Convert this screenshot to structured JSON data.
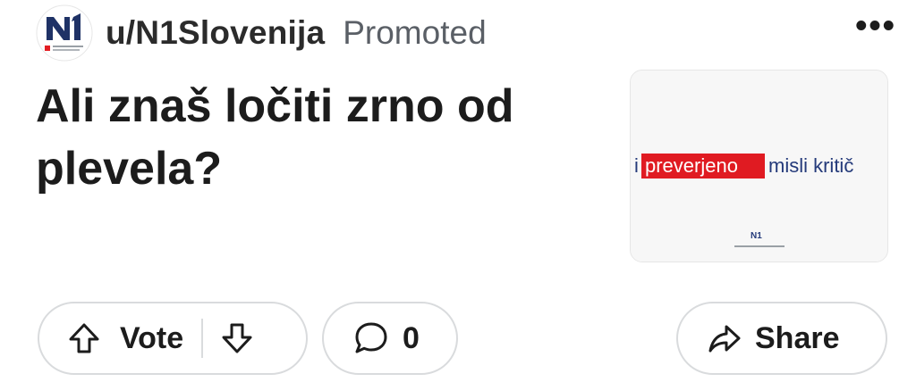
{
  "post": {
    "username": "u/N1Slovenija",
    "promoted_label": "Promoted",
    "more_label": "•••",
    "title": "Ali znaš ločiti zrno od plevela?",
    "thumbnail": {
      "ad_text_highlight": "preverjeno",
      "ad_text_prefix": "i",
      "ad_text_rest": "misli kritič",
      "brand_mark": "N1"
    }
  },
  "actions": {
    "vote_label": "Vote",
    "comment_count": "0",
    "share_label": "Share"
  },
  "icons": {
    "upvote": "arrow-up-outline-icon",
    "downvote": "arrow-down-outline-icon",
    "comment": "speech-bubble-icon",
    "share": "share-arrow-icon"
  },
  "colors": {
    "avatar_navy": "#1f3266",
    "avatar_red": "#e31e24",
    "ad_red": "#e01b22",
    "ad_navy": "#243a7a"
  }
}
